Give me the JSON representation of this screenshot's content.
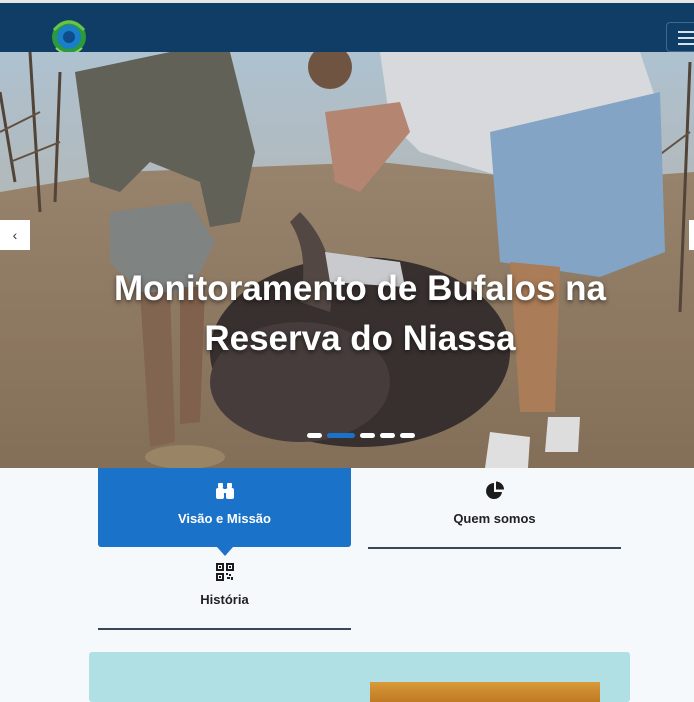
{
  "header": {
    "logo_icon": "nature-emblem-logo",
    "menu_icon": "hamburger-menu-icon"
  },
  "hero": {
    "title": "Monitoramento de Bufalos na Reserva do Niassa",
    "prev_icon": "chevron-left-icon",
    "prev_glyph": "‹",
    "slide_count": 5,
    "active_slide": 2
  },
  "tabs": [
    {
      "label": "Visão e Missão",
      "icon": "binoculars-icon",
      "active": true
    },
    {
      "label": "Quem somos",
      "icon": "pie-chart-icon",
      "active": false
    },
    {
      "label": "História",
      "icon": "qr-code-icon",
      "active": false
    }
  ],
  "colors": {
    "navbar": "#103d66",
    "accent": "#1a73c8",
    "panel": "#b0e0e4"
  }
}
